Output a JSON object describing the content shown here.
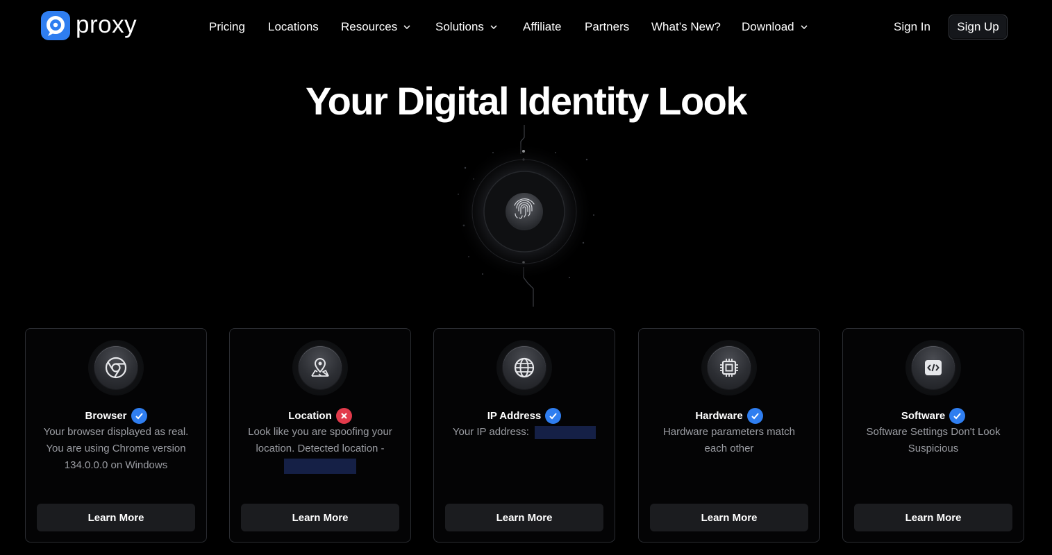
{
  "brand": {
    "name": "proxy",
    "accent": "#2f7ef0"
  },
  "nav": {
    "items": [
      {
        "label": "Pricing",
        "dropdown": false
      },
      {
        "label": "Locations",
        "dropdown": false
      },
      {
        "label": "Resources",
        "dropdown": true
      },
      {
        "label": "Solutions",
        "dropdown": true
      },
      {
        "label": "Affiliate",
        "dropdown": false
      },
      {
        "label": "Partners",
        "dropdown": false
      },
      {
        "label": "What’s New?",
        "dropdown": false
      },
      {
        "label": "Download",
        "dropdown": true
      }
    ],
    "sign_in": "Sign In",
    "sign_up": "Sign Up"
  },
  "hero": {
    "title": "Your Digital Identity Look",
    "graphic_icon": "fingerprint-icon"
  },
  "cards": [
    {
      "title": "Browser",
      "status": "ok",
      "icon": "chrome-icon",
      "desc": "Your browser displayed as real. You are using Chrome version 134.0.0.0 on Windows",
      "button": "Learn More"
    },
    {
      "title": "Location",
      "status": "bad",
      "icon": "map-pin-icon",
      "desc": "Look like you are spoofing your location. Detected location -",
      "button": "Learn More"
    },
    {
      "title": "IP Address",
      "status": "ok",
      "icon": "globe-icon",
      "desc": "Your IP address:",
      "button": "Learn More"
    },
    {
      "title": "Hardware",
      "status": "ok",
      "icon": "chip-icon",
      "desc": "Hardware parameters match each other",
      "button": "Learn More"
    },
    {
      "title": "Software",
      "status": "ok",
      "icon": "code-icon",
      "desc": "Software Settings Don't Look Suspicious",
      "button": "Learn More"
    }
  ],
  "colors": {
    "ok": "#2f7ef0",
    "bad": "#e23a4b",
    "muted_text": "#9b9da3",
    "redacted": "#152046"
  }
}
